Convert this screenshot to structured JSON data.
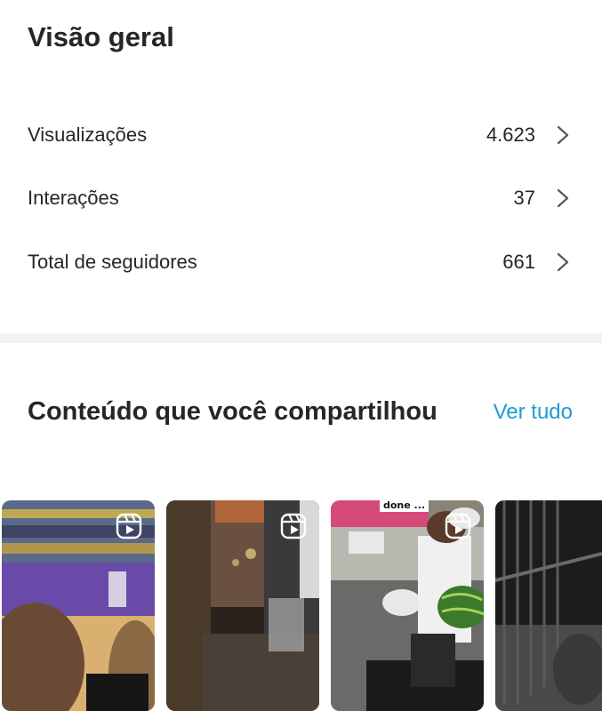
{
  "overview": {
    "title": "Visão geral",
    "metrics": [
      {
        "label": "Visualizações",
        "value": "4.623"
      },
      {
        "label": "Interações",
        "value": "37"
      },
      {
        "label": "Total de seguidores",
        "value": "661"
      }
    ]
  },
  "shared_content": {
    "title": "Conteúdo que você compartilhou",
    "see_all": "Ver tudo",
    "link_color": "#1f9bd7",
    "thumbnails": [
      {
        "type": "reel",
        "icon": "reel-icon",
        "description_colors": [
          "#6a4aa8",
          "#e8c53a"
        ]
      },
      {
        "type": "reel",
        "icon": "reel-icon",
        "description_colors": [
          "#3a2a22",
          "#7a5a3a"
        ]
      },
      {
        "type": "reel",
        "icon": "reel-icon",
        "caption": "done ...",
        "description_colors": [
          "#d64a7a",
          "#3a7a2a"
        ]
      },
      {
        "type": "reel",
        "icon": "reel-icon",
        "description_colors": [
          "#2a2a2a",
          "#5a5a5a"
        ]
      }
    ]
  }
}
